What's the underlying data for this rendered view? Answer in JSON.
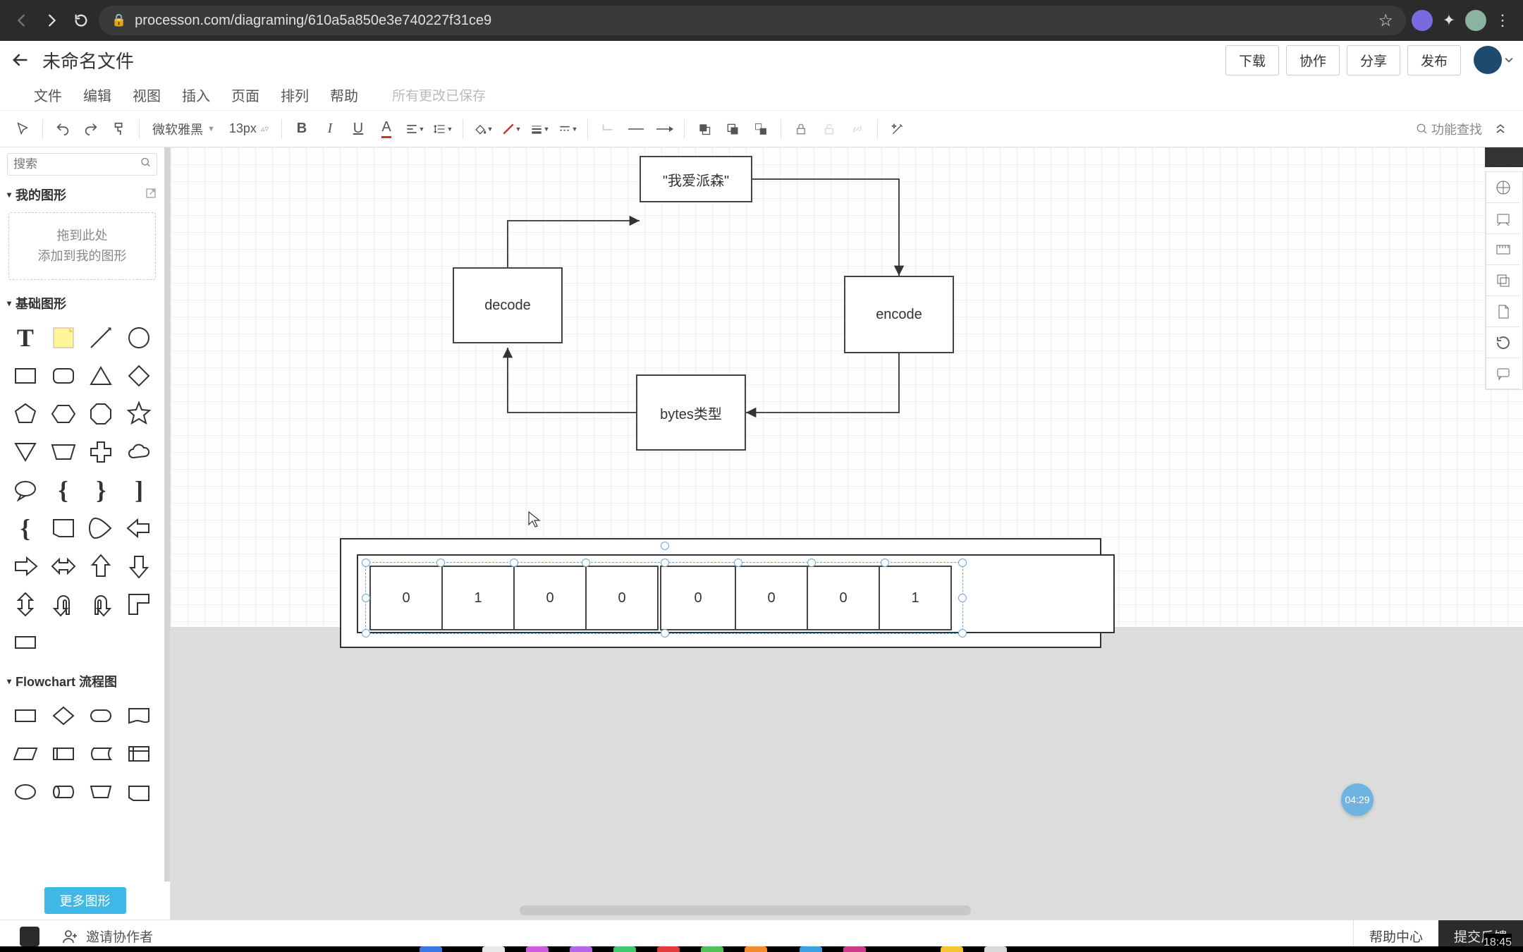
{
  "browser": {
    "url": "processon.com/diagraming/610a5a850e3e740227f31ce9"
  },
  "header": {
    "title": "未命名文件",
    "buttons": {
      "download": "下载",
      "collab": "协作",
      "share": "分享",
      "publish": "发布"
    }
  },
  "menu": {
    "file": "文件",
    "edit": "编辑",
    "view": "视图",
    "insert": "插入",
    "page": "页面",
    "arrange": "排列",
    "help": "帮助",
    "saveStatus": "所有更改已保存"
  },
  "toolbar": {
    "font": "微软雅黑",
    "fontSize": "13px",
    "funcSearch": "功能查找"
  },
  "sidebar": {
    "searchPlaceholder": "搜索",
    "myShapes": "我的图形",
    "dropZone1": "拖到此处",
    "dropZone2": "添加到我的图形",
    "basicShapes": "基础图形",
    "flowchart": "Flowchart 流程图",
    "moreShapes": "更多图形"
  },
  "canvas": {
    "nodes": {
      "top": "\"我爱派森\"",
      "decode": "decode",
      "encode": "encode",
      "bytes": "bytes类型"
    },
    "bits": [
      "0",
      "1",
      "0",
      "0",
      "0",
      "0",
      "0",
      "1"
    ]
  },
  "badge": {
    "time": "04:29"
  },
  "bottom": {
    "invite": "邀请协作者",
    "help": "帮助中心",
    "feedback": "提交反馈"
  },
  "taskbar": {
    "clock": "18:45"
  }
}
